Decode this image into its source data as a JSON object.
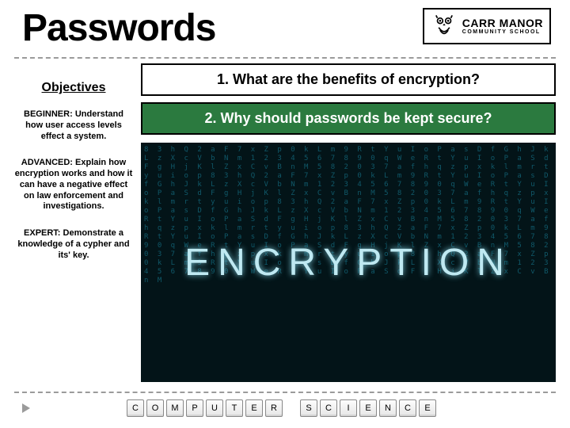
{
  "header": {
    "title": "Passwords",
    "school_main": "CARR MANOR",
    "school_sub": "COMMUNITY SCHOOL"
  },
  "sidebar": {
    "heading": "Objectives",
    "beginner_label": "BEGINNER:",
    "beginner_text": "Understand how user access levels effect a system.",
    "advanced_label": "ADVANCED:",
    "advanced_text": "Explain how encryption works and how it can have a negative effect on law enforcement and investigations.",
    "expert_label": "EXPERT:",
    "expert_text": "Demonstrate a knowledge of a cypher and its' key."
  },
  "questions": {
    "q1": "1. What are the benefits of encryption?",
    "q2": "2. Why should passwords be kept secure?"
  },
  "image": {
    "word": "ENCRYPTION",
    "noise": "8 3 h Q 2 a F 7 x Z p 0 k L m 9 R t Y u I o P a s D f G h J k L z X c V b N m 1 2 3 4 5 6 7 8 9 0 q W e R t Y u I o P a S d F g H j K l Z x C v B n M 5 8 2 0 3 7 a f h q z p x k l m r t y u i o p 8 3 h Q 2 a F 7 x Z p 0 k L m 9 R t Y u I o P a s D f G h J k L z X c V b N m 1 2 3 4 5 6 7 8 9 0 q W e R t Y u I o P a S d F g H j K l Z x C v B n M 5 8 2 0 3 7 a f h q z p x k l m r t y u i o p 8 3 h Q 2 a F 7 x Z p 0 k L m 9 R t Y u I o P a s D f G h J k L z X c V b N m 1 2 3 4 5 6 7 8 9 0 q W e R t Y u I o P a S d F g H j K l Z x C v B n M 5 8 2 0 3 7 a f h q z p x k l m r t y u i o p 8 3 h Q 2 a F 7 x Z p 0 k L m 9 R t Y u I o P a s D f G h J k L z X c V b N m 1 2 3 4 5 6 7 8 9 0 q W e R t Y u I o P a S d F g H j K l Z x C v B n M 5 8 2 0 3 7 a f h q z p x k l m r t y u i o p 8 3 h Q 2 a F 7 x Z p 0 k L m 9 R t Y u I o P a s D f G h J k L z X c V b N m 1 2 3 4 5 6 7 8 9 0 q W e R t Y u I o P a S d F g H j K l Z x C v B n M"
  },
  "keys1": [
    "C",
    "O",
    "M",
    "P",
    "U",
    "T",
    "E",
    "R"
  ],
  "keys2": [
    "S",
    "C",
    "I",
    "E",
    "N",
    "C",
    "E"
  ]
}
